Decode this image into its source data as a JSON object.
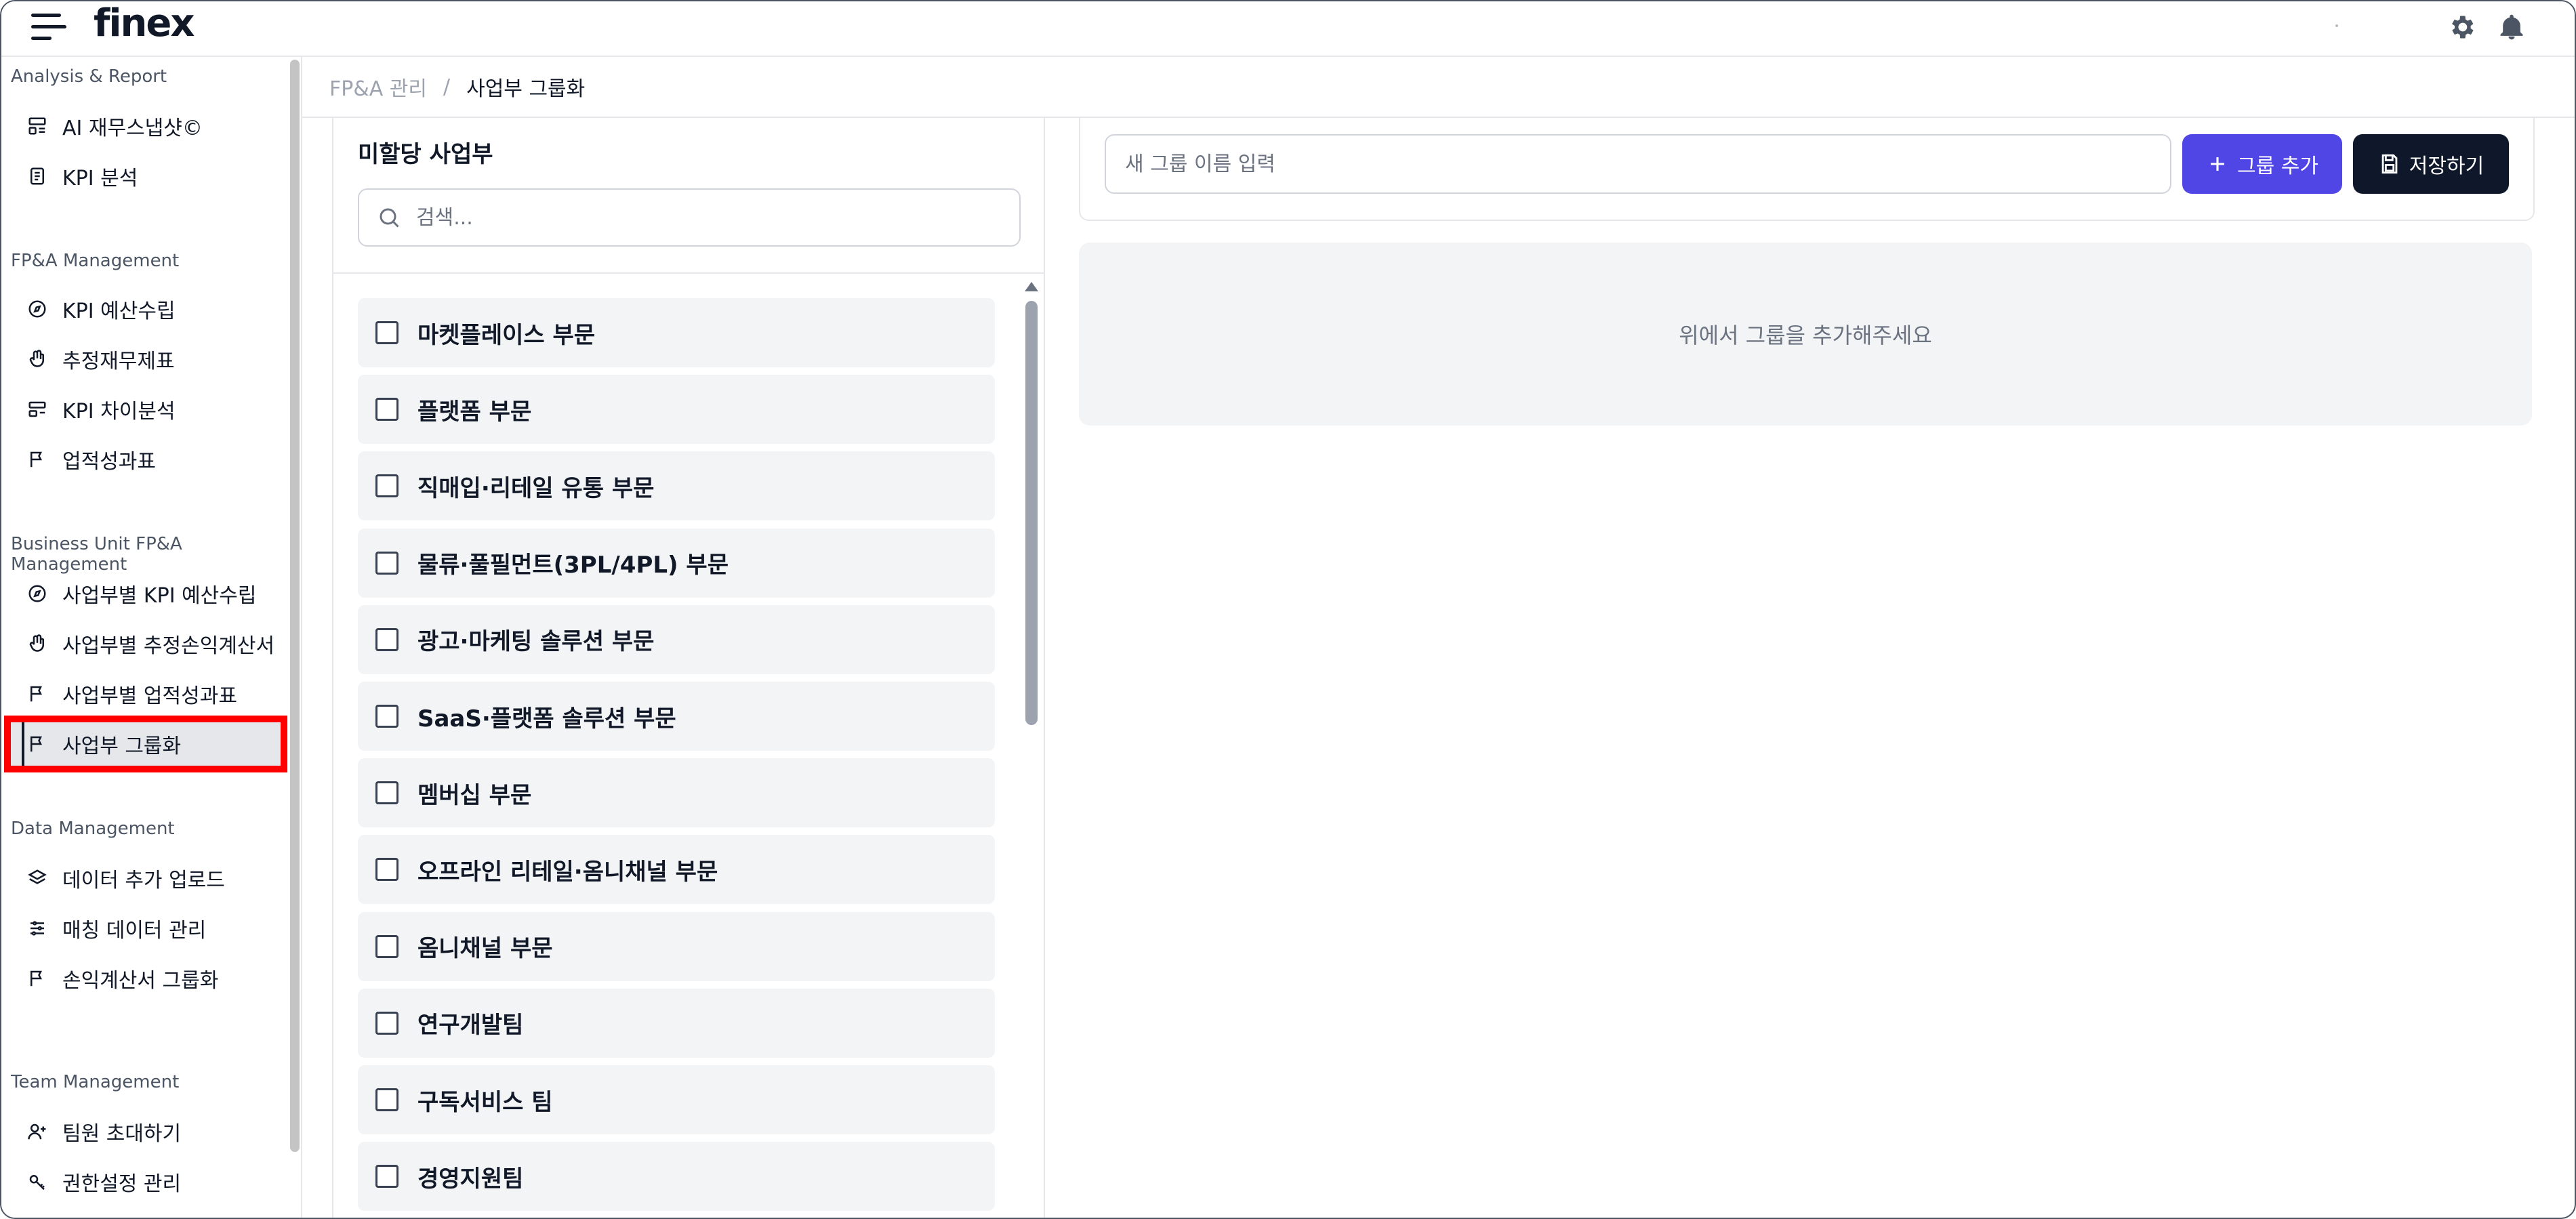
{
  "header": {
    "logo": "finex",
    "icons": [
      "menu-icon",
      "gear-icon",
      "bell-icon"
    ]
  },
  "sidebar": {
    "sections": [
      {
        "title": "Analysis & Report",
        "items": [
          {
            "label": "AI 재무스냅샷©",
            "icon": "dashboard-icon"
          },
          {
            "label": "KPI 분석",
            "icon": "document-icon"
          }
        ]
      },
      {
        "title": "FP&A Management",
        "items": [
          {
            "label": "KPI 예산수립",
            "icon": "compass-icon"
          },
          {
            "label": "추정재무제표",
            "icon": "hand-icon"
          },
          {
            "label": "KPI 차이분석",
            "icon": "layout-icon"
          },
          {
            "label": "업적성과표",
            "icon": "flag-icon"
          }
        ]
      },
      {
        "title": "Business Unit FP&A Management",
        "items": [
          {
            "label": "사업부별 KPI 예산수립",
            "icon": "compass-icon"
          },
          {
            "label": "사업부별 추정손익계산서",
            "icon": "hand-icon"
          },
          {
            "label": "사업부별 업적성과표",
            "icon": "flag-icon"
          },
          {
            "label": "사업부 그룹화",
            "icon": "flag-icon",
            "active": true
          }
        ]
      },
      {
        "title": "Data Management",
        "items": [
          {
            "label": "데이터 추가 업로드",
            "icon": "layers-icon"
          },
          {
            "label": "매칭 데이터 관리",
            "icon": "sliders-icon"
          },
          {
            "label": "손익계산서 그룹화",
            "icon": "flag-icon"
          }
        ]
      },
      {
        "title": "Team Management",
        "items": [
          {
            "label": "팀원 초대하기",
            "icon": "user-plus-icon"
          },
          {
            "label": "권한설정 관리",
            "icon": "key-icon"
          }
        ]
      }
    ]
  },
  "breadcrumb": {
    "parent": "FP&A 관리",
    "separator": "/",
    "current": "사업부 그룹화"
  },
  "unassigned": {
    "title": "미할당 사업부",
    "search_placeholder": "검색...",
    "items": [
      "마켓플레이스 부문",
      "플랫폼 부문",
      "직매입·리테일 유통 부문",
      "물류·풀필먼트(3PL/4PL) 부문",
      "광고·마케팅 솔루션 부문",
      "SaaS·플랫폼 솔루션 부문",
      "멤버십 부문",
      "오프라인 리테일·옴니채널 부문",
      "옴니채널 부문",
      "연구개발팀",
      "구독서비스 팀",
      "경영지원팀"
    ]
  },
  "groups": {
    "input_placeholder": "새 그룹 이름 입력",
    "add_button": "그룹 추가",
    "save_button": "저장하기",
    "empty_message": "위에서 그룹을 추가해주세요"
  },
  "colors": {
    "accent": "#4f46e5",
    "save_button": "#0f172a",
    "highlight": "#ff0000"
  }
}
